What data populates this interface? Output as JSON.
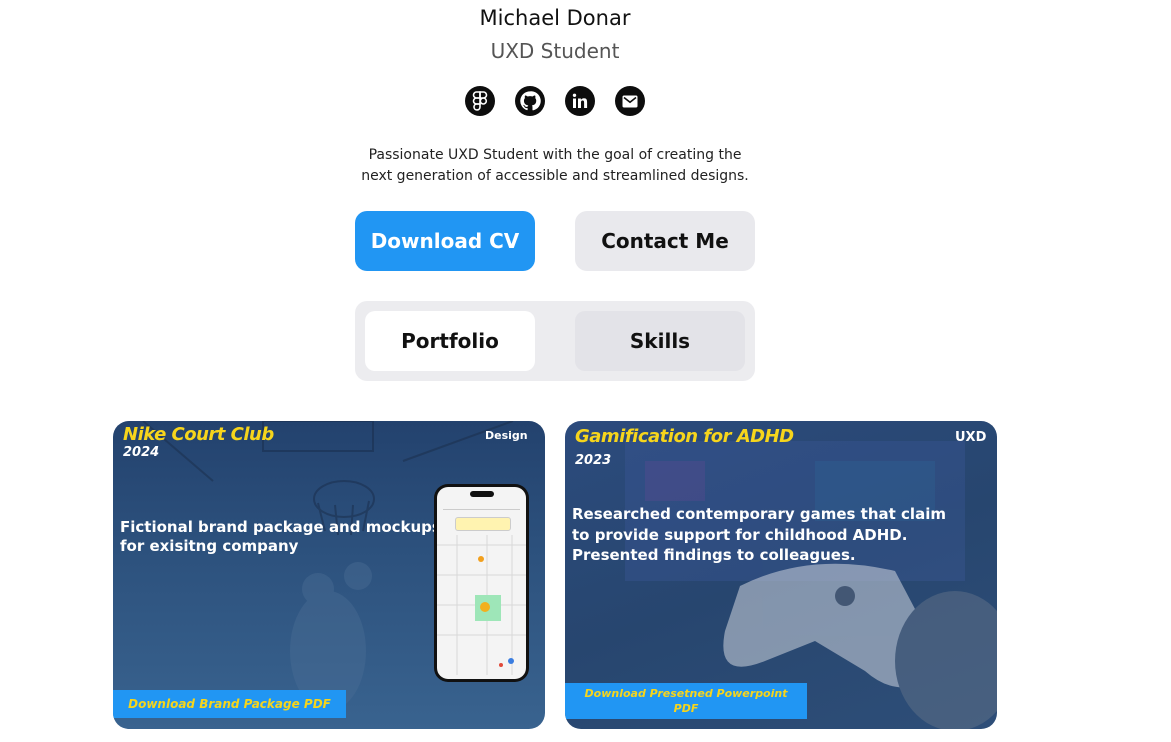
{
  "profile": {
    "name": "Michael Donar",
    "role": "UXD Student",
    "bio_line1": "Passionate UXD Student with the goal of creating the",
    "bio_line2": "next generation of accessible and streamlined designs."
  },
  "socials": [
    {
      "icon": "figma-icon"
    },
    {
      "icon": "github-icon"
    },
    {
      "icon": "linkedin-icon"
    },
    {
      "icon": "email-icon"
    }
  ],
  "actions": {
    "download_cv": "Download CV",
    "contact_me": "Contact Me"
  },
  "tabs": {
    "portfolio": "Portfolio",
    "skills": "Skills",
    "active": "Portfolio"
  },
  "colors": {
    "accent": "#2196f3",
    "title_yellow": "#f6d51c",
    "card_bg": "#2d527e"
  },
  "cards": [
    {
      "title": "Nike Court Club",
      "year": "2024",
      "tag": "Design",
      "desc_line1": "Fictional brand package and mockups",
      "desc_line2": "for exisitng company",
      "download": "Download Brand Package PDF"
    },
    {
      "title": "Gamification for ADHD",
      "year": "2023",
      "tag": "UXD",
      "desc_line1": "Researched contemporary games that claim",
      "desc_line2": "to provide support for childhood ADHD.",
      "desc_line3": "Presented findings to colleagues.",
      "download_line1": "Download Presetned Powerpoint",
      "download_line2": "PDF"
    }
  ]
}
